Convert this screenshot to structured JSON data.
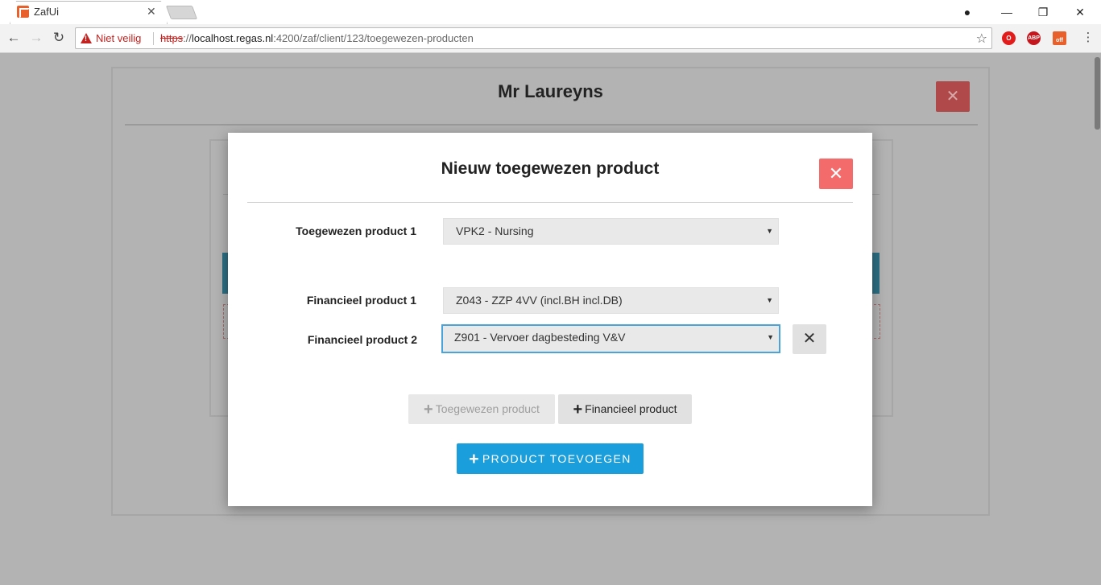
{
  "browser": {
    "tab_title": "ZafUi",
    "tab_close": "✕",
    "security_label": "Niet veilig",
    "url_scheme": "https",
    "url_separator": "://",
    "url_host": "localhost.regas.nl",
    "url_path": ":4200/zaf/client/123/toegewezen-producten",
    "extensions": [
      "O",
      "ABP",
      "off"
    ]
  },
  "background": {
    "dialog_title": "Mr Laureyns"
  },
  "modal": {
    "title": "Nieuw toegewezen product",
    "assigned_products": [
      {
        "label": "Toegewezen product 1",
        "value": "VPK2 - Nursing"
      }
    ],
    "financial_products": [
      {
        "label": "Financieel product 1",
        "value": "Z043 - ZZP 4VV (incl.BH incl.DB)"
      },
      {
        "label": "Financieel product 2",
        "value": "Z901 - Vervoer dagbesteding V&V"
      }
    ],
    "add_assigned_label": "Toegewezen product",
    "add_financial_label": "Financieel product",
    "submit_label": "PRODUCT TOEVOEGEN"
  },
  "icons": {
    "close": "✕",
    "plus": "+",
    "caret": "▼",
    "back": "←",
    "forward": "→",
    "reload": "↻",
    "star": "☆",
    "minimize": "—",
    "maximize": "❐",
    "window_close": "✕",
    "profile": "●"
  },
  "colors": {
    "modal_close": "#f36b6b",
    "primary": "#1a9fdc",
    "focus": "#4aa3d9",
    "warning": "#c5221f"
  }
}
